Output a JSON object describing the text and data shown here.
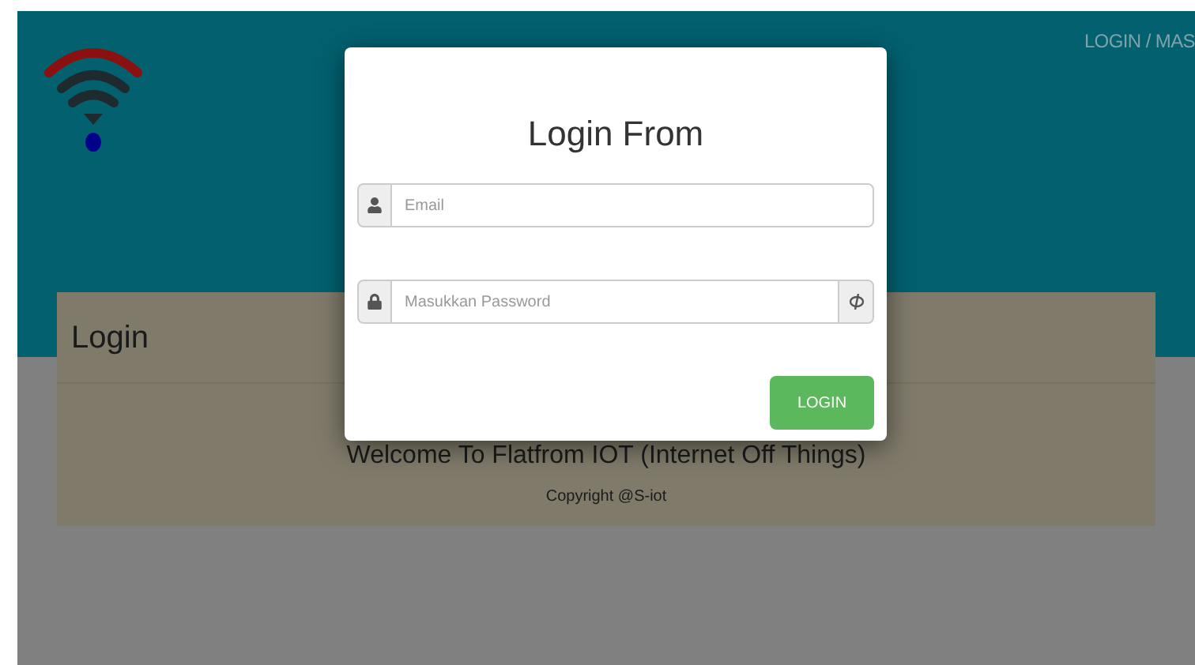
{
  "header": {
    "nav_link": "LOGIN / MAS"
  },
  "card": {
    "title": "Login",
    "welcome": "Welcome To Flatfrom IOT (Internet Off Things)",
    "copyright": "Copyright @S-iot"
  },
  "modal": {
    "title": "Login From",
    "fields": [
      {
        "kind": "email",
        "placeholder": "Email"
      },
      {
        "kind": "password",
        "placeholder": "Masukkan Password"
      }
    ],
    "button": "LOGIN"
  }
}
